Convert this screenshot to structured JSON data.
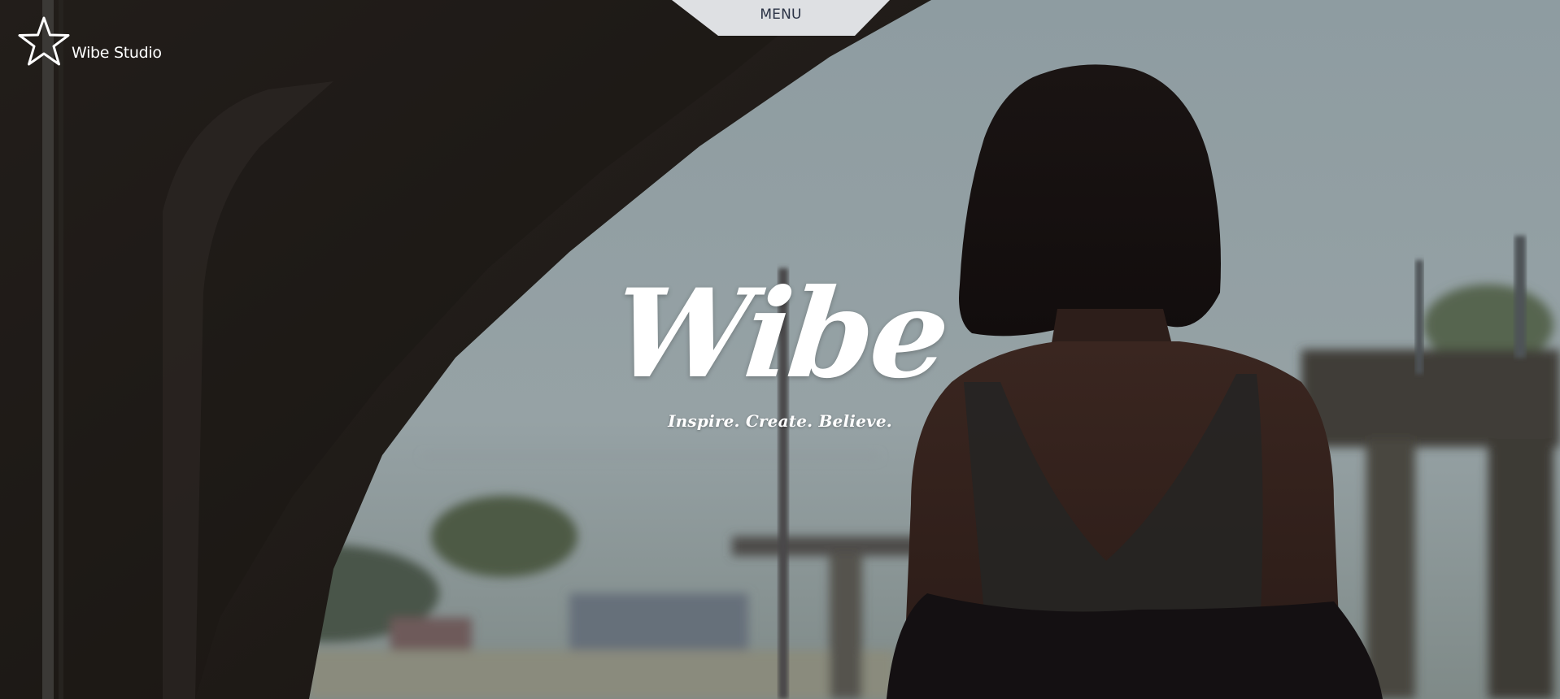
{
  "brand": {
    "name": "Wibe Studio",
    "logo_icon": "star-outline-icon"
  },
  "nav": {
    "menu_label": "MENU"
  },
  "hero": {
    "title": "Wibe",
    "tagline": "Inspire. Create. Believe.",
    "background": "photo of a woman seen from behind on a train platform"
  },
  "colors": {
    "text": "#ffffff",
    "menu_tab_bg": "#e9ebee",
    "menu_text": "#2a3245",
    "sky": "#8f9ca1",
    "shadow": "#1e1b19"
  }
}
